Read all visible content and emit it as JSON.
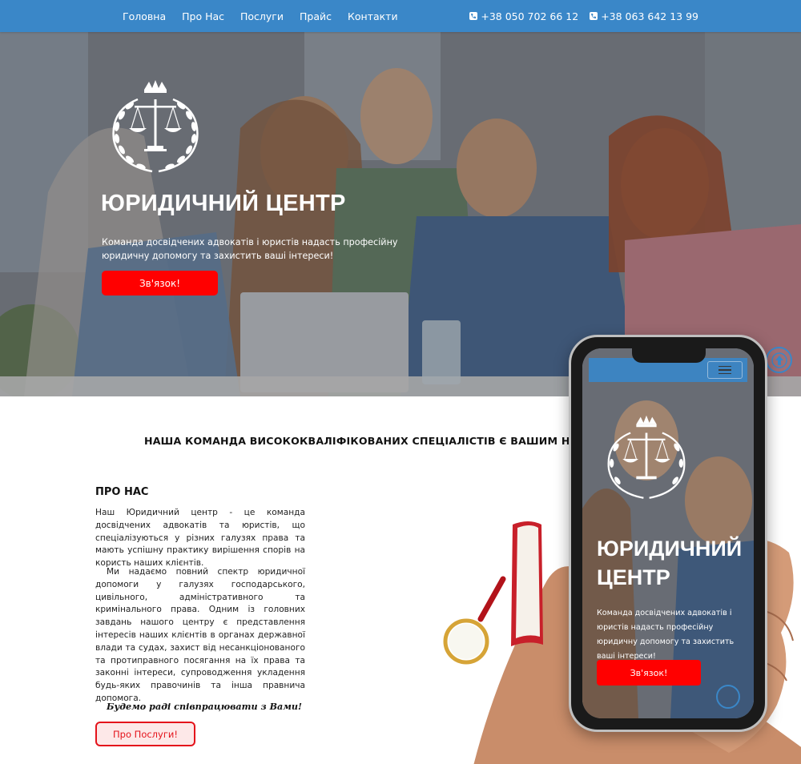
{
  "nav": {
    "links": [
      "Головна",
      "Про Нас",
      "Послуги",
      "Прайс",
      "Контакти"
    ],
    "phones": [
      "+38 050 702 66 12",
      "+38 063 642 13 99"
    ],
    "bar_color": "#3a87c8"
  },
  "hero": {
    "title": "ЮРИДИЧНИЙ ЦЕНТР",
    "description": "Команда досвідчених адвокатів і юристів надасть професійну юридичну допомогу та захистить ваші інтереси!",
    "button": "Зв'язок!",
    "button_color": "#ff0000",
    "logo_icon": "scales-of-justice-crown-wreath-icon"
  },
  "section": {
    "heading": "НАША КОМАНДА ВИСОКОКВАЛІФІКОВАНИХ СПЕЦІАЛІСТІВ Є ВАШИМ НАДІЙНИ"
  },
  "about": {
    "title": "ПРО НАС",
    "paragraph1": "Наш Юридичний центр - це команда досвідчених адвокатів та юристів, що спеціалізуються у різних галузях права та мають успішну практику вирішення спорів на користь наших клієнтів.",
    "paragraph2": "Ми надаємо повний спектр юридичної допомоги у галузях господарського, цивільного, адміністративного та кримінального права. Одним із головних завдань нашого центру є представлення інтересів наших клієнтів в органах державної влади та судах, захист від несанкціонованого та протиправного посягання на їх права та законні інтереси, супроводження укладення будь-яких правочинів та інша правнича допомога.",
    "welcome": "Будемо раді співпрацювати з Вами!",
    "services_button": "Про Послуги!"
  },
  "mobile_preview": {
    "title_line1": "ЮРИДИЧНИЙ",
    "title_line2": "ЦЕНТР",
    "description": "Команда досвідчених адвокатів і юристів надасть професійну юридичну допомогу та захистить ваші інтереси!",
    "button": "Зв'язок!"
  }
}
